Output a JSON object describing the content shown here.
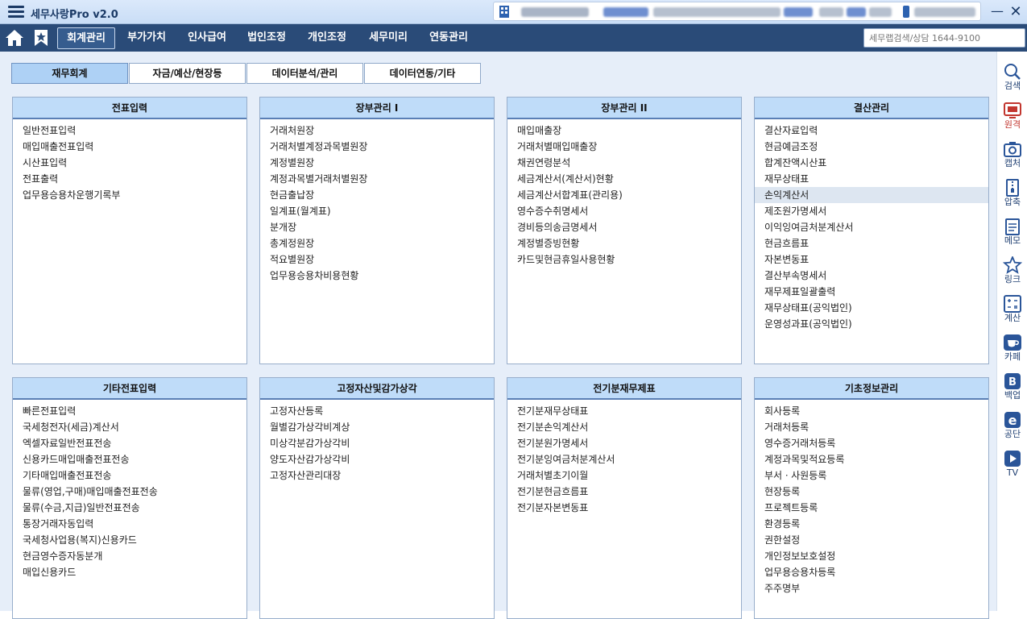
{
  "titlebar": {
    "app_title": "세무사랑Pro v2.0"
  },
  "nav": {
    "items": [
      "회계관리",
      "부가가치",
      "인사급여",
      "법인조정",
      "개인조정",
      "세무미리",
      "연동관리"
    ],
    "active": "회계관리",
    "search_placeholder": "세무랩검색/상담 1644-9100"
  },
  "tabs": [
    "재무회계",
    "자금/예산/현장등",
    "데이터분석/관리",
    "데이터연동/기타"
  ],
  "panels": [
    {
      "title": "전표입력",
      "items": [
        "일반전표입력",
        "매입매출전표입력",
        "시산표입력",
        "전표출력",
        "업무용승용차운행기록부"
      ]
    },
    {
      "title": "장부관리 I",
      "items": [
        "거래처원장",
        "거래처별계정과목별원장",
        "계정별원장",
        "계정과목별거래처별원장",
        "현금출납장",
        "일계표(월계표)",
        "분개장",
        "총계정원장",
        "적요별원장",
        "업무용승용차비용현황"
      ]
    },
    {
      "title": "장부관리 II",
      "items": [
        "매입매출장",
        "거래처별매입매출장",
        "채권연령분석",
        "세금계산서(계산서)현황",
        "세금계산서합계표(관리용)",
        "영수증수취명세서",
        "경비등의송금명세서",
        "계정별증빙현황",
        "카드및현금휴일사용현황"
      ]
    },
    {
      "title": "결산관리",
      "items": [
        "결산자료입력",
        "현금예금조정",
        "합계잔액시산표",
        "재무상태표",
        "손익계산서",
        "제조원가명세서",
        "이익잉여금처분계산서",
        "현금흐름표",
        "자본변동표",
        "결산부속명세서",
        "재무제표일괄출력",
        "재무상태표(공익법인)",
        "운영성과표(공익법인)"
      ],
      "highlighted": "손익계산서"
    },
    {
      "title": "기타전표입력",
      "items": [
        "빠른전표입력",
        "국세청전자(세금)계산서",
        "엑셀자료일반전표전송",
        "신용카드매입매출전표전송",
        "기타매입매출전표전송",
        "물류(영업,구매)매입매출전표전송",
        "물류(수금,지급)일반전표전송",
        "통장거래자동입력",
        "국세청사업용(복지)신용카드",
        "현금영수증자동분개",
        "매입신용카드"
      ]
    },
    {
      "title": "고정자산및감가상각",
      "items": [
        "고정자산등록",
        "월별감가상각비계상",
        "미상각분감가상각비",
        "양도자산감가상각비",
        "고정자산관리대장"
      ]
    },
    {
      "title": "전기분재무제표",
      "items": [
        "전기분재무상태표",
        "전기분손익계산서",
        "전기분원가명세서",
        "전기분잉여금처분계산서",
        "거래처별초기이월",
        "전기분현금흐름표",
        "전기분자본변동표"
      ]
    },
    {
      "title": "기초정보관리",
      "items": [
        "회사등록",
        "거래처등록",
        "영수증거래처등록",
        "계정과목및적요등록",
        "부서ㆍ사원등록",
        "현장등록",
        "프로젝트등록",
        "환경등록",
        "권한설정",
        "개인정보보호설정",
        "업무용승용차등록",
        "주주명부"
      ]
    }
  ],
  "sidebar": {
    "items": [
      {
        "label": "검색",
        "icon": "search-icon"
      },
      {
        "label": "원격",
        "icon": "remote-support-icon"
      },
      {
        "label": "캡처",
        "icon": "camera-icon"
      },
      {
        "label": "압축",
        "icon": "zip-icon"
      },
      {
        "label": "메모",
        "icon": "memo-icon"
      },
      {
        "label": "링크",
        "icon": "star-link-icon"
      },
      {
        "label": "계산",
        "icon": "calculator-icon"
      },
      {
        "label": "카페",
        "icon": "coffee-icon"
      },
      {
        "label": "백업",
        "icon": "backup-icon"
      },
      {
        "label": "공단",
        "icon": "e-icon"
      },
      {
        "label": "TV",
        "icon": "tv-icon"
      }
    ]
  },
  "colors": {
    "navbar": "#2a4b78",
    "tab_active": "#aed1f5",
    "panel_header": "#bfdcf9",
    "accent_red": "#c2362f"
  }
}
